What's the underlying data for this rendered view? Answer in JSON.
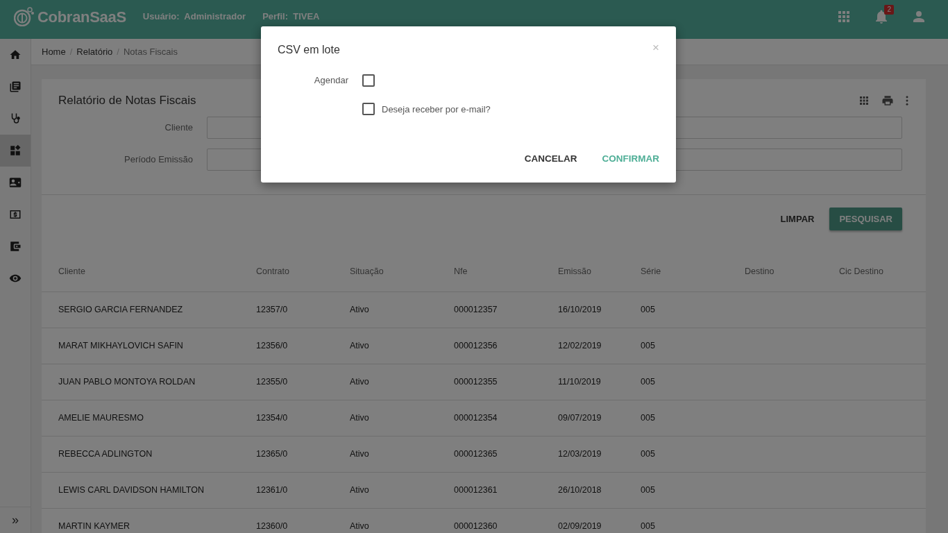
{
  "header": {
    "logo": "CobranSaaS",
    "user_label": "Usuário:",
    "user_value": "Administrador",
    "profile_label": "Perfil:",
    "profile_value": "TIVEA",
    "notification_count": "2"
  },
  "sidebar": {
    "items": [
      {
        "selected": false
      },
      {
        "selected": false
      },
      {
        "selected": false
      },
      {
        "selected": true
      },
      {
        "selected": false
      },
      {
        "selected": false
      },
      {
        "selected": false
      },
      {
        "selected": false
      }
    ],
    "expand": "»"
  },
  "breadcrumb": {
    "items": [
      "Home",
      "Relatório",
      "Notas Fiscais"
    ],
    "separators": [
      "/",
      "/"
    ]
  },
  "report": {
    "title": "Relatório de Notas Fiscais",
    "fields": [
      {
        "label": "Cliente"
      },
      {
        "label": "Período Emissão"
      }
    ],
    "buttons": [
      {
        "label": "LIMPAR",
        "kind": "text"
      },
      {
        "label": "PESQUISAR",
        "kind": "raised"
      }
    ],
    "table": {
      "columns": [
        "Cliente",
        "Contrato",
        "Situação",
        "Nfe",
        "Emissão",
        "Série",
        "Destino",
        "Cic Destino"
      ],
      "rows": [
        [
          "SERGIO GARCIA FERNANDEZ",
          "12357/0",
          "Ativo",
          "000012357",
          "16/10/2019",
          "005"
        ],
        [
          "MARAT MIKHAYLOVICH SAFIN",
          "12356/0",
          "Ativo",
          "000012356",
          "12/02/2019",
          "005"
        ],
        [
          "JUAN PABLO MONTOYA ROLDAN",
          "12355/0",
          "Ativo",
          "000012355",
          "11/10/2019",
          "005"
        ],
        [
          "AMELIE MAURESMO",
          "12354/0",
          "Ativo",
          "000012354",
          "09/07/2019",
          "005"
        ],
        [
          "REBECCA ADLINGTON",
          "12365/0",
          "Ativo",
          "000012365",
          "12/03/2019",
          "005"
        ],
        [
          "LEWIS CARL DAVIDSON HAMILTON",
          "12361/0",
          "Ativo",
          "000012361",
          "26/10/2018",
          "005"
        ],
        [
          "MARTIN KAYMER",
          "12360/0",
          "Ativo",
          "000012360",
          "02/09/2019",
          "005"
        ]
      ]
    }
  },
  "modal": {
    "title": "CSV em lote",
    "close": "×",
    "options": [
      {
        "label": "Agendar",
        "kind": "labeled",
        "checked": false
      },
      {
        "label": "Deseja receber por e-mail?",
        "kind": "inline",
        "checked": false
      }
    ],
    "buttons": [
      {
        "label": "CANCELAR",
        "kind": "plain"
      },
      {
        "label": "CONFIRMAR",
        "kind": "primary"
      }
    ]
  }
}
